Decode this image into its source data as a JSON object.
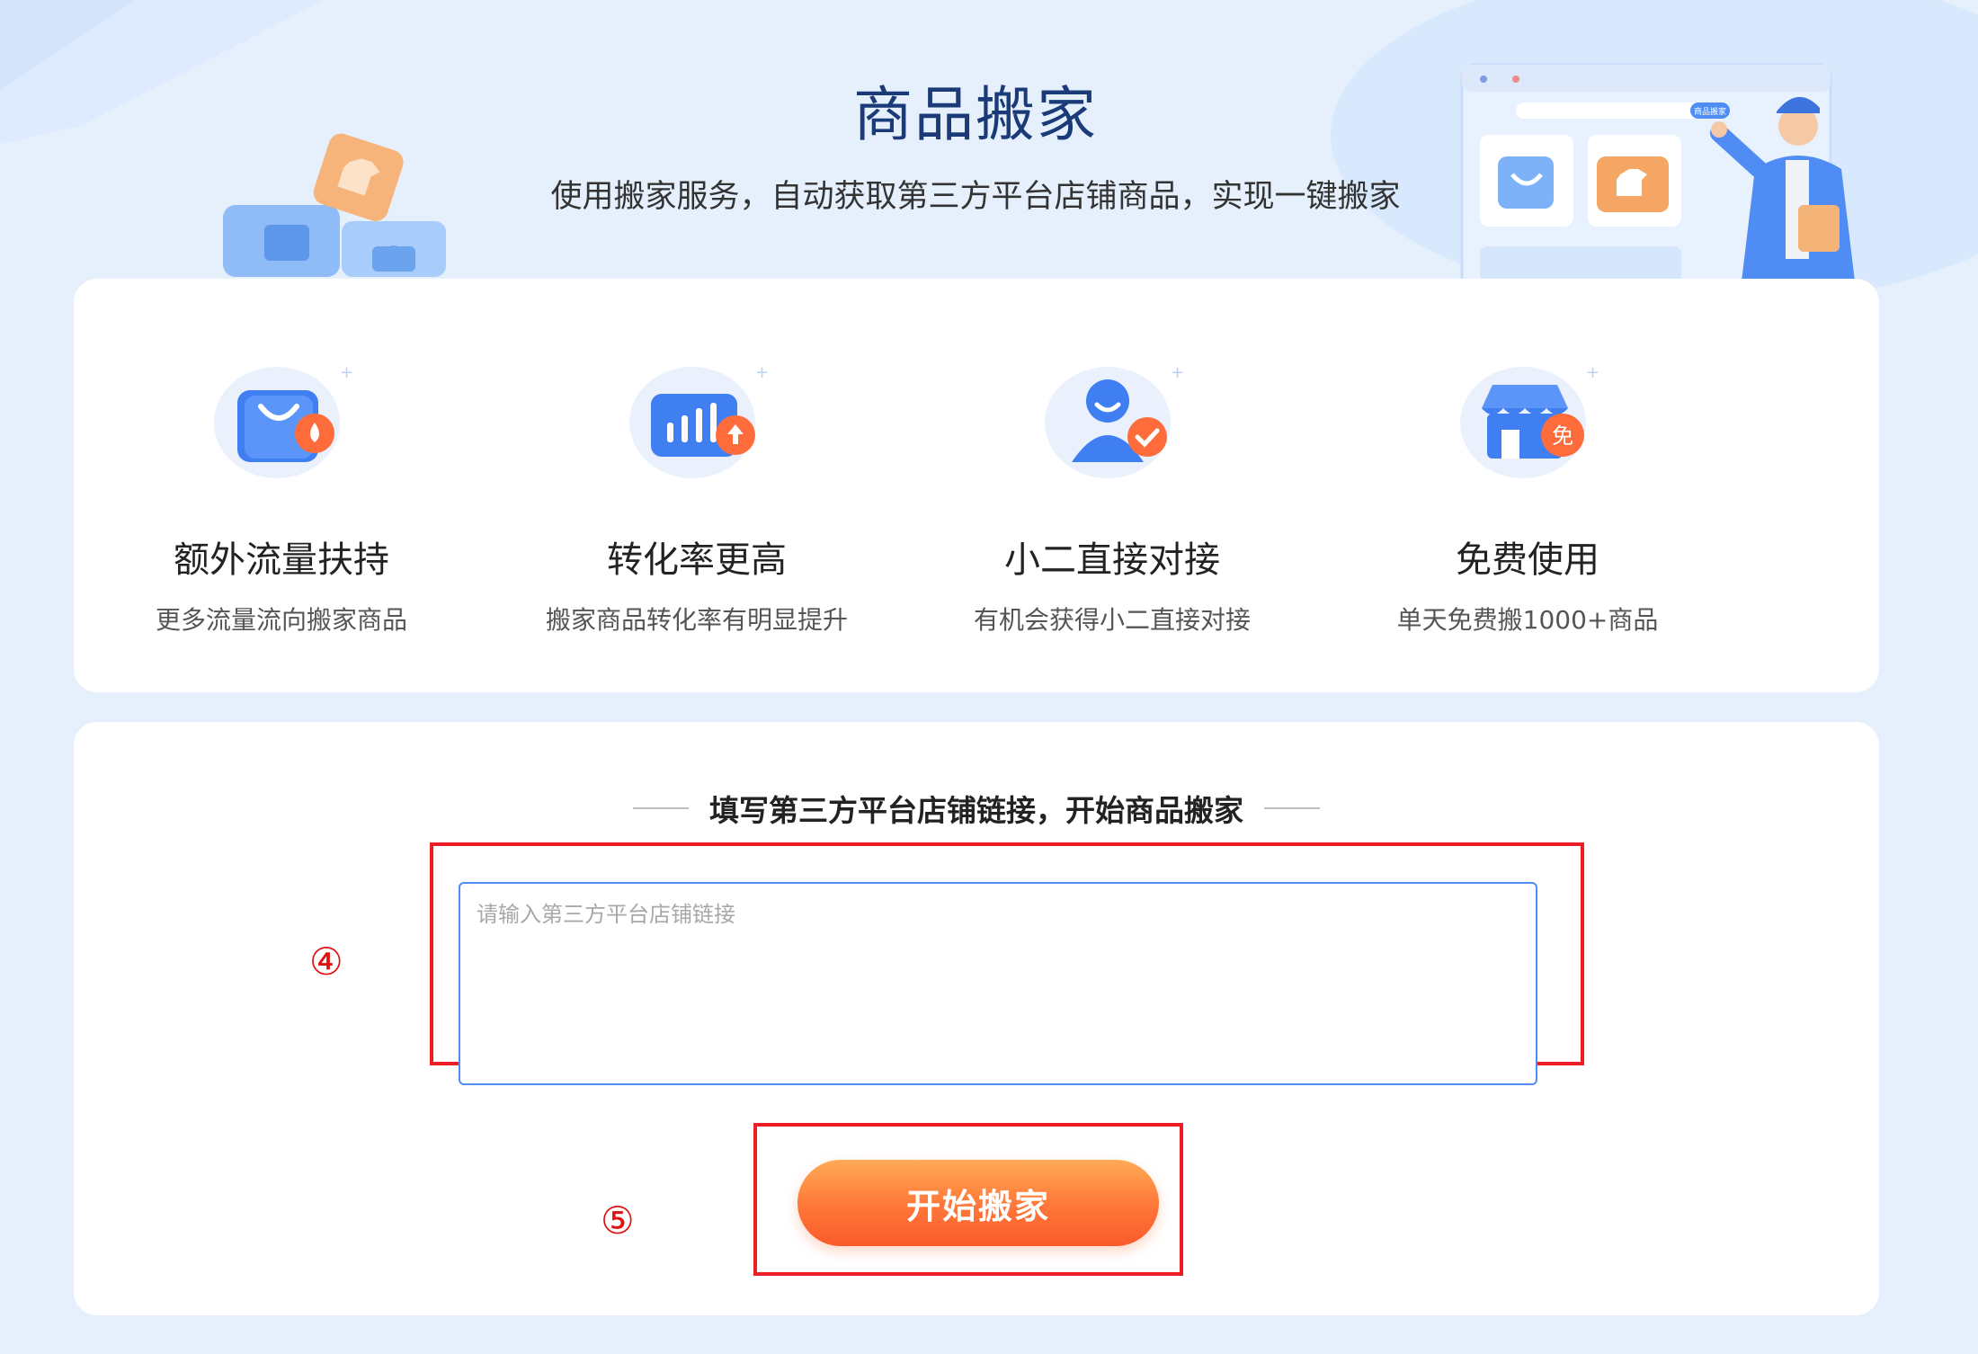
{
  "header": {
    "title": "商品搬家",
    "subtitle": "使用搬家服务，自动获取第三方平台店铺商品，实现一键搬家",
    "banner_badge": "商品搬家"
  },
  "features": [
    {
      "title": "额外流量扶持",
      "desc": "更多流量流向搬家商品",
      "icon": "shopping-bag-flow-icon"
    },
    {
      "title": "转化率更高",
      "desc": "搬家商品转化率有明显提升",
      "icon": "bar-chart-up-icon"
    },
    {
      "title": "小二直接对接",
      "desc": "有机会获得小二直接对接",
      "icon": "person-check-icon"
    },
    {
      "title": "免费使用",
      "desc": "单天免费搬1000+商品",
      "icon": "store-free-icon",
      "badge": "免"
    }
  ],
  "form": {
    "heading": "填写第三方平台店铺链接，开始商品搬家",
    "input_placeholder": "请输入第三方平台店铺链接",
    "input_value": "",
    "submit_label": "开始搬家"
  },
  "annotations": {
    "step4": "④",
    "step5": "⑤"
  },
  "colors": {
    "page_bg": "#e6f0fd",
    "title": "#1b3b78",
    "accent_blue": "#3f80f5",
    "button_orange": "#ff7638",
    "annotation_red": "#ee1c25"
  }
}
